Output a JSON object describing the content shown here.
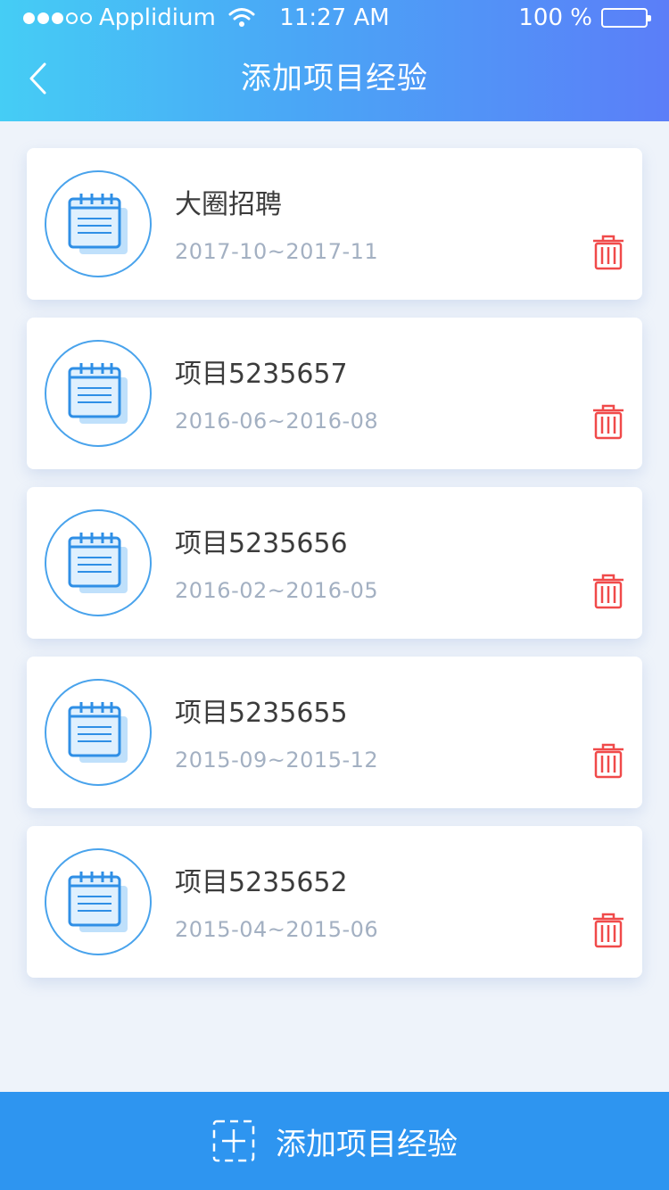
{
  "status_bar": {
    "carrier": "Applidium",
    "time": "11:27 AM",
    "battery": "100 %"
  },
  "nav": {
    "back_icon": "chevron-left-icon",
    "title": "添加项目经验"
  },
  "projects": [
    {
      "title": "大圈招聘",
      "date_range": "2017-10~2017-11"
    },
    {
      "title": "项目5235657",
      "date_range": "2016-06~2016-08"
    },
    {
      "title": "项目5235656",
      "date_range": "2016-02~2016-05"
    },
    {
      "title": "项目5235655",
      "date_range": "2015-09~2015-12"
    },
    {
      "title": "项目5235652",
      "date_range": "2015-04~2015-06"
    }
  ],
  "footer": {
    "add_label": "添加项目经验",
    "add_icon": "add-square-icon"
  },
  "colors": {
    "header_start": "#45cdf5",
    "header_end": "#5b7ef8",
    "accent": "#2e95f0",
    "delete": "#f04a4a",
    "date_text": "#a3b0c2"
  }
}
